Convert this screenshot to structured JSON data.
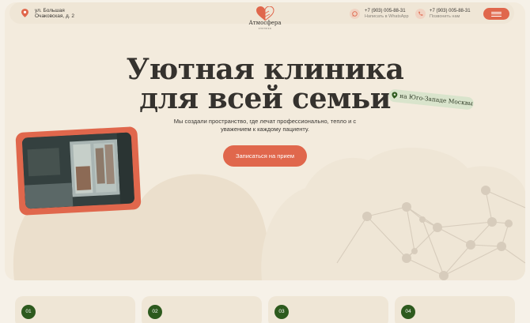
{
  "header": {
    "address": "ул. Большая\nОчаковская, д. 2",
    "logo_name": "Атмосфера",
    "logo_sub": "клиника",
    "contacts": [
      {
        "phone": "+7 (903) 005-88-31",
        "note": "Написать в WhatsApp",
        "icon": "whatsapp-icon"
      },
      {
        "phone": "+7 (903) 005-88-31",
        "note": "Позвонить нам",
        "icon": "phone-icon"
      }
    ]
  },
  "hero": {
    "headline_line1": "Уютная клиника",
    "headline_line2": "для всей семьи",
    "location_badge": "на Юго-Западе Москвы",
    "lead": "Мы создали пространство, где лечат профессионально, тепло и с уважением к каждому пациенту.",
    "cta_label": "Записаться на прием"
  },
  "cards": [
    {
      "number": "01"
    },
    {
      "number": "02"
    },
    {
      "number": "03"
    },
    {
      "number": "04"
    }
  ],
  "colors": {
    "accent": "#e0674c",
    "background": "#f3ebdd",
    "number_badge": "#2d5a1e",
    "badge_green": "#d9e4cc"
  }
}
